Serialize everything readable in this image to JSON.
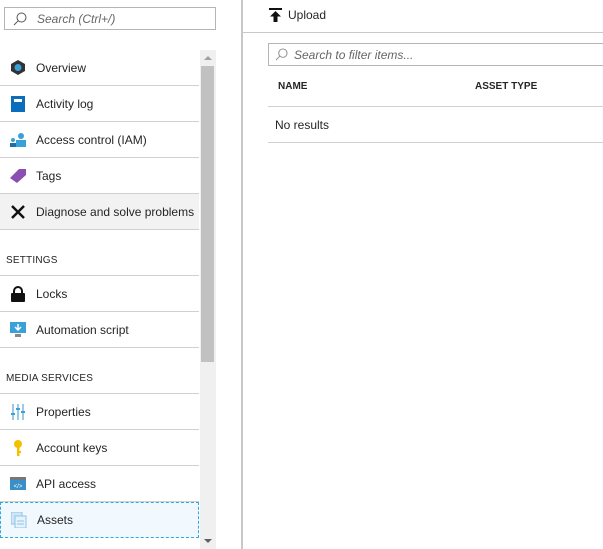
{
  "sidebar": {
    "search_placeholder": "Search (Ctrl+/)",
    "items": [
      {
        "label": "Overview",
        "icon": "overview-icon"
      },
      {
        "label": "Activity log",
        "icon": "activity-log-icon"
      },
      {
        "label": "Access control (IAM)",
        "icon": "iam-icon"
      },
      {
        "label": "Tags",
        "icon": "tag-icon"
      },
      {
        "label": "Diagnose and solve problems",
        "icon": "wrench-icon"
      }
    ],
    "settings_header": "SETTINGS",
    "settings_items": [
      {
        "label": "Locks",
        "icon": "lock-icon"
      },
      {
        "label": "Automation script",
        "icon": "automation-script-icon"
      }
    ],
    "media_header": "MEDIA SERVICES",
    "media_items": [
      {
        "label": "Properties",
        "icon": "properties-icon"
      },
      {
        "label": "Account keys",
        "icon": "key-icon"
      },
      {
        "label": "API access",
        "icon": "api-icon"
      },
      {
        "label": "Assets",
        "icon": "assets-icon"
      }
    ]
  },
  "main": {
    "upload_label": "Upload",
    "filter_placeholder": "Search to filter items...",
    "columns": [
      "NAME",
      "ASSET TYPE"
    ],
    "empty_text": "No results"
  }
}
